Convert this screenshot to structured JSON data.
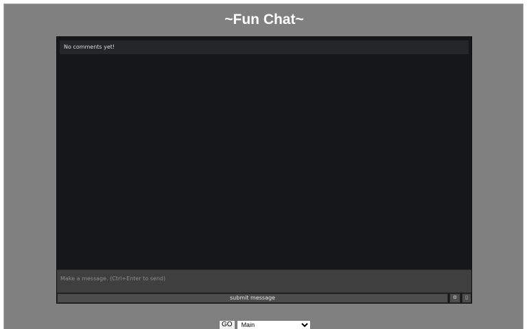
{
  "header": {
    "title": "~Fun Chat~"
  },
  "chat": {
    "empty_text": "No comments yet!",
    "input_placeholder": "Make a message. (Ctrl+Enter to send)",
    "input_value": "",
    "submit_label": "submit message",
    "settings_icon_glyph": "⚙",
    "settings_icon_name": "gear-icon",
    "scroll_icon_glyph": "▯",
    "scroll_icon_name": "box-icon"
  },
  "room": {
    "go_label": "GO",
    "selected": "Main",
    "options": [
      "Main"
    ]
  },
  "colors": {
    "page_background": "#808080",
    "chat_background": "#161718",
    "comment_bar": "#252627",
    "input_background": "#3f3f3f",
    "button_background": "#4d4d4d"
  }
}
